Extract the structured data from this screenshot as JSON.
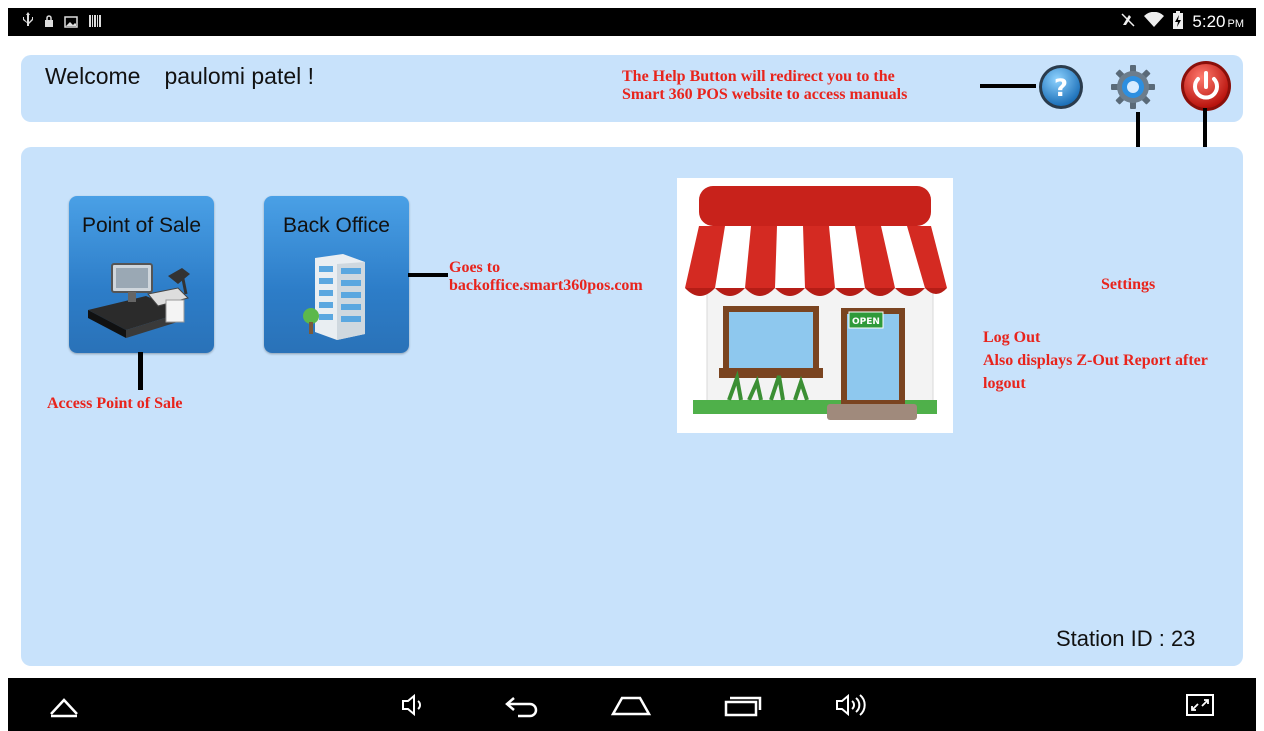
{
  "status_bar": {
    "left_icons": [
      "usb-icon",
      "lock-icon",
      "image-icon",
      "barcode-icon"
    ],
    "right_icons": [
      "mute-icon",
      "wifi-icon",
      "battery-icon"
    ],
    "time": "5:20",
    "ampm": "PM"
  },
  "header": {
    "welcome": "Welcome",
    "user_name": "paulomi patel !",
    "buttons": [
      "help-icon",
      "settings-gear-icon",
      "power-icon"
    ]
  },
  "tiles": [
    {
      "label": "Point of Sale",
      "icon": "pos-terminal-icon"
    },
    {
      "label": "Back Office",
      "icon": "office-building-icon"
    }
  ],
  "annotations": {
    "help_line1": "The Help Button will redirect you to the",
    "help_line2": "Smart 360 POS website to access manuals",
    "backoffice_line1": "Goes to",
    "backoffice_line2": "backoffice.smart360pos.com",
    "access_pos": "Access Point of Sale",
    "settings": "Settings",
    "logout_line1": "Log Out",
    "logout_line2": "Also displays Z-Out Report after",
    "logout_line3": "logout"
  },
  "store_image": {
    "sign": "OPEN"
  },
  "station": "Station ID : 23",
  "nav_bar": [
    "up-icon",
    "volume-down-icon",
    "back-icon",
    "home-icon",
    "recents-icon",
    "volume-up-icon",
    "screenshot-icon"
  ],
  "colors": {
    "panel": "#c8e2fb",
    "annotation": "#e8241c",
    "tile": "#2d7dc8"
  }
}
